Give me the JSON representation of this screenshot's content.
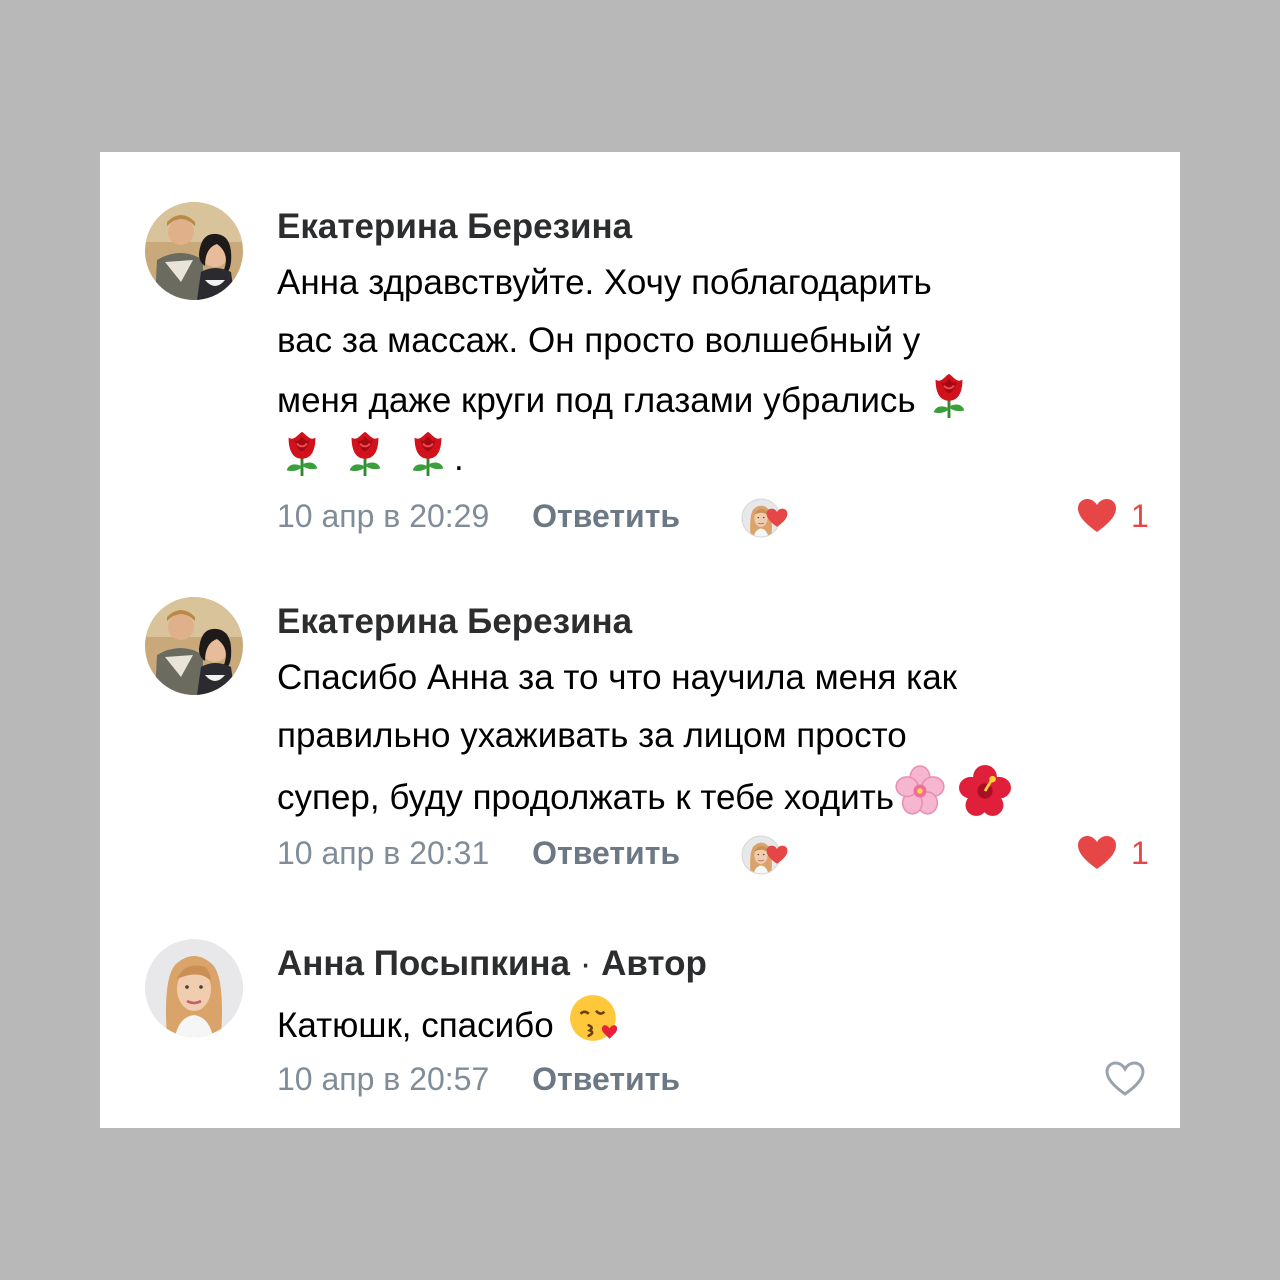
{
  "comments": [
    {
      "author": "Екатерина Березина",
      "author_tag": "",
      "lines": [
        "Анна здравствуйте.  Хочу поблагодарить",
        "вас за массаж. Он просто волшебный у",
        "меня даже круги под глазами убрались",
        "."
      ],
      "emoji": [
        "rose-icon",
        "rose-icon",
        "rose-icon",
        "rose-icon"
      ],
      "date": "10 апр в 20:29",
      "reply": "Ответить",
      "likes": "1",
      "liked": true
    },
    {
      "author": "Екатерина Березина",
      "author_tag": "",
      "lines": [
        "Спасибо Анна за то что научила меня как",
        "правильно ухаживать за лицом просто",
        "супер, буду продолжать к тебе ходить"
      ],
      "emoji": [
        "cherry-blossom-icon",
        "hibiscus-icon"
      ],
      "date": "10 апр в 20:31",
      "reply": "Ответить",
      "likes": "1",
      "liked": true
    },
    {
      "author": "Анна Посыпкина",
      "author_tag": "Автор",
      "author_sep": "·",
      "lines": [
        "Катюшк, спасибо"
      ],
      "emoji": [
        "kissing-face-icon"
      ],
      "date": "10 апр в 20:57",
      "reply": "Ответить",
      "likes": "",
      "liked": false
    }
  ],
  "colors": {
    "background": "#b8b8b8",
    "card": "#ffffff",
    "author_text": "#2c2d2e",
    "meta_text": "#818c99",
    "like_red": "#e64646"
  }
}
